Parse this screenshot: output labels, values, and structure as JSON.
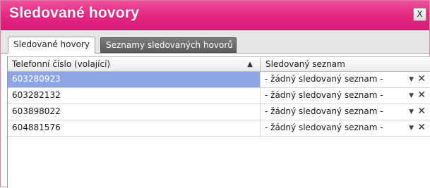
{
  "window": {
    "title": "Sledované hovory",
    "close_label": "X"
  },
  "tabs": [
    {
      "label": "Sledované hovory",
      "active": true
    },
    {
      "label": "Seznamy sledovaných hovorů",
      "active": false
    }
  ],
  "grid": {
    "columns": [
      {
        "label": "Telefonní číslo (volající)",
        "sort": "ascending"
      },
      {
        "label": "Sledovaný seznam"
      }
    ],
    "rows": [
      {
        "phone": "603280923",
        "list": "- žádný sledovaný seznam -",
        "selected": true
      },
      {
        "phone": "603282132",
        "list": "- žádný sledovaný seznam -",
        "selected": false
      },
      {
        "phone": "603898022",
        "list": "- žádný sledovaný seznam -",
        "selected": false
      },
      {
        "phone": "604881576",
        "list": "- žádný sledovaný seznam -",
        "selected": false
      }
    ],
    "icons": {
      "sort": "sort-ascending-icon",
      "dropdown": "chevron-down-icon",
      "remove": "close-icon"
    }
  },
  "colors": {
    "titlebar": "#e52b84",
    "selection": "#8da5e6",
    "inactive_tab": "#6a6a6a"
  }
}
